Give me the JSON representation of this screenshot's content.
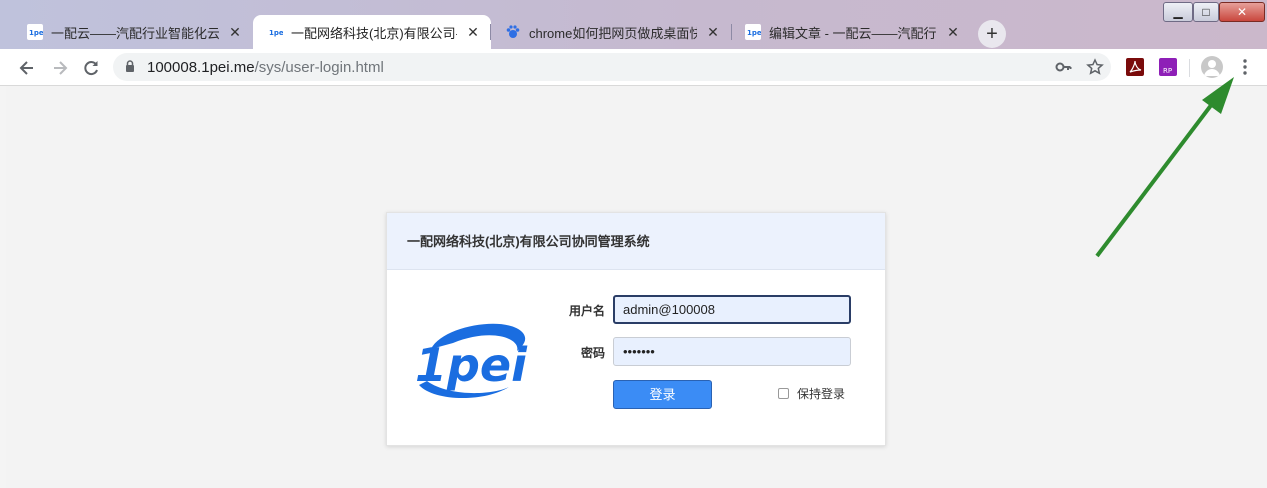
{
  "browser": {
    "tabs": [
      {
        "title": "一配云——汽配行业智能化云管",
        "active": false
      },
      {
        "title": "一配网络科技(北京)有限公司--gu",
        "active": true
      },
      {
        "title": "chrome如何把网页做成桌面快捷",
        "active": false
      },
      {
        "title": "编辑文章 - 一配云——汽配行业",
        "active": false
      }
    ],
    "new_tab": "+",
    "window_controls": {
      "minimize": "▁",
      "maximize": "□",
      "close": "✕"
    },
    "url_host": "100008.1pei.me",
    "url_path": "/sys/user-login.html",
    "toolbar_icons": [
      "back-icon",
      "forward-icon",
      "reload-icon",
      "lock-icon",
      "key-icon",
      "star-icon",
      "adobe-pdf-icon",
      "axure-rp-icon",
      "profile-icon",
      "menu-icon"
    ],
    "ext_labels": {
      "rp": "RP"
    }
  },
  "login": {
    "header": "一配网络科技(北京)有限公司协同管理系统",
    "logo_text": "1pei",
    "username_label": "用户名",
    "username_value": "admin@100008",
    "password_label": "密码",
    "password_value": "•••••••",
    "login_button": "登录",
    "remember_label": "保持登录"
  },
  "colors": {
    "accent": "#3b8cf5",
    "header_bg": "#ecf2fd",
    "logo_blue": "#1a6de0",
    "annotation_arrow": "#2e8b2e"
  }
}
